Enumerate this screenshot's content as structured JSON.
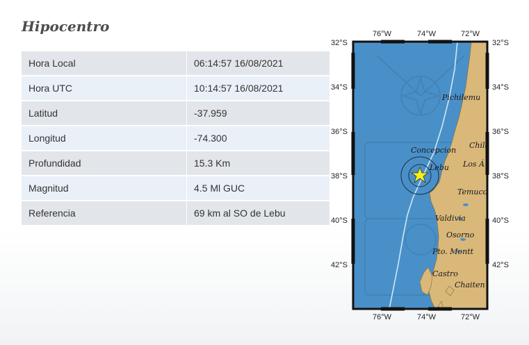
{
  "section": {
    "title": "Hipocentro"
  },
  "table": {
    "rows": [
      {
        "label": "Hora Local",
        "value": "06:14:57 16/08/2021"
      },
      {
        "label": "Hora UTC",
        "value": "10:14:57 16/08/2021"
      },
      {
        "label": "Latitud",
        "value": "-37.959"
      },
      {
        "label": "Longitud",
        "value": "-74.300"
      },
      {
        "label": "Profundidad",
        "value": "15.3 Km"
      },
      {
        "label": "Magnitud",
        "value": "4.5 Ml GUC"
      },
      {
        "label": "Referencia",
        "value": "69 km al SO de Lebu"
      }
    ]
  },
  "map": {
    "top_labels": [
      "76°W",
      "74°W",
      "72°W"
    ],
    "bottom_labels": [
      "76°W",
      "74°W",
      "72°W"
    ],
    "left_labels": [
      "32°S",
      "34°S",
      "36°S",
      "38°S",
      "40°S",
      "42°S"
    ],
    "right_labels": [
      "32°S",
      "34°S",
      "36°S",
      "38°S",
      "40°S",
      "42°S"
    ],
    "places": [
      "Pichilemu",
      "Chile",
      "Concepcion",
      "Los Á",
      "Lebu",
      "Temuco",
      "Valdivia",
      "Osorno",
      "Pto. Montt",
      "Castro",
      "Chaiten"
    ],
    "colors": {
      "ocean": "#4a90c8",
      "land": "#d9b87a",
      "epicenter": "#f2f21a"
    }
  }
}
